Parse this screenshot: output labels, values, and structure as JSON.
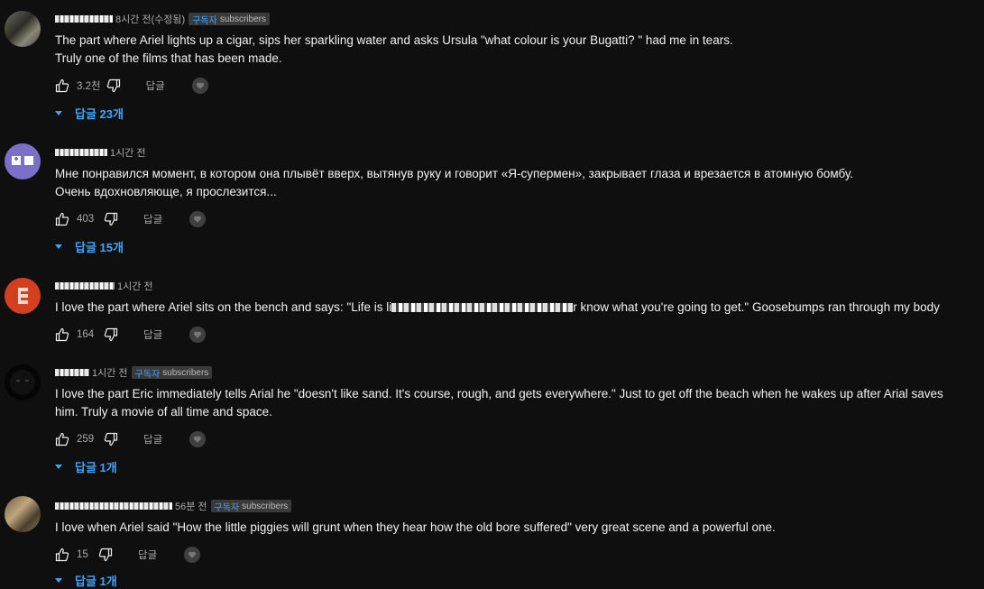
{
  "comments": [
    {
      "time": "8시간 전(수정됨)",
      "badge_ko": "구독자",
      "badge_en": "subscribers",
      "text": "The part where Ariel lights up a cigar, sips her sparkling water and asks Ursula \"what colour is your Bugatti? \" had me in tears.\nTruly one of the films that has been made.",
      "likes": "3.2천",
      "reply_label": "답글",
      "replies_label": "답글 23개"
    },
    {
      "time": "1시간 전",
      "text": "Мне понравился момент, в котором она плывёт вверх, вытянув руку и говорит «Я-супермен», закрывает глаза и врезается в атомную бомбу.\nОчень вдохновляюще, я прослезится...",
      "likes": "403",
      "reply_label": "답글",
      "replies_label": "답글 15개"
    },
    {
      "time": "1시간 전",
      "text_a": "I love the part where Ariel sits on the bench and says: \"Life is li",
      "text_b": "r know what you're going to get.\" Goosebumps ran through my body",
      "likes": "164",
      "reply_label": "답글"
    },
    {
      "time": "1시간 전",
      "badge_ko": "구독자",
      "badge_en": "subscribers",
      "text": "I love the part Eric immediately tells Arial he \"doesn't like sand. It's course, rough, and gets everywhere.\" Just to get off the beach when he wakes up after Arial saves\nhim. Truly a movie of all time and space.",
      "likes": "259",
      "reply_label": "답글",
      "replies_label": "답글 1개"
    },
    {
      "time": "56분 전",
      "badge_ko": "구독자",
      "badge_en": "subscribers",
      "text": "I love when Ariel said \"How the little piggies will grunt when they hear how the old bore suffered\" very great scene and a powerful one.",
      "likes": "15",
      "reply_label": "답글",
      "replies_label": "답글 1개"
    }
  ],
  "icons": {
    "like": "thumbs-up-icon",
    "dislike": "thumbs-down-icon",
    "heart": "creator-heart-icon",
    "caret": "caret-down-icon"
  },
  "colors": {
    "background": "#0f0f0f",
    "accent": "#3ea6ff",
    "secondary_text": "#aaaaaa"
  }
}
